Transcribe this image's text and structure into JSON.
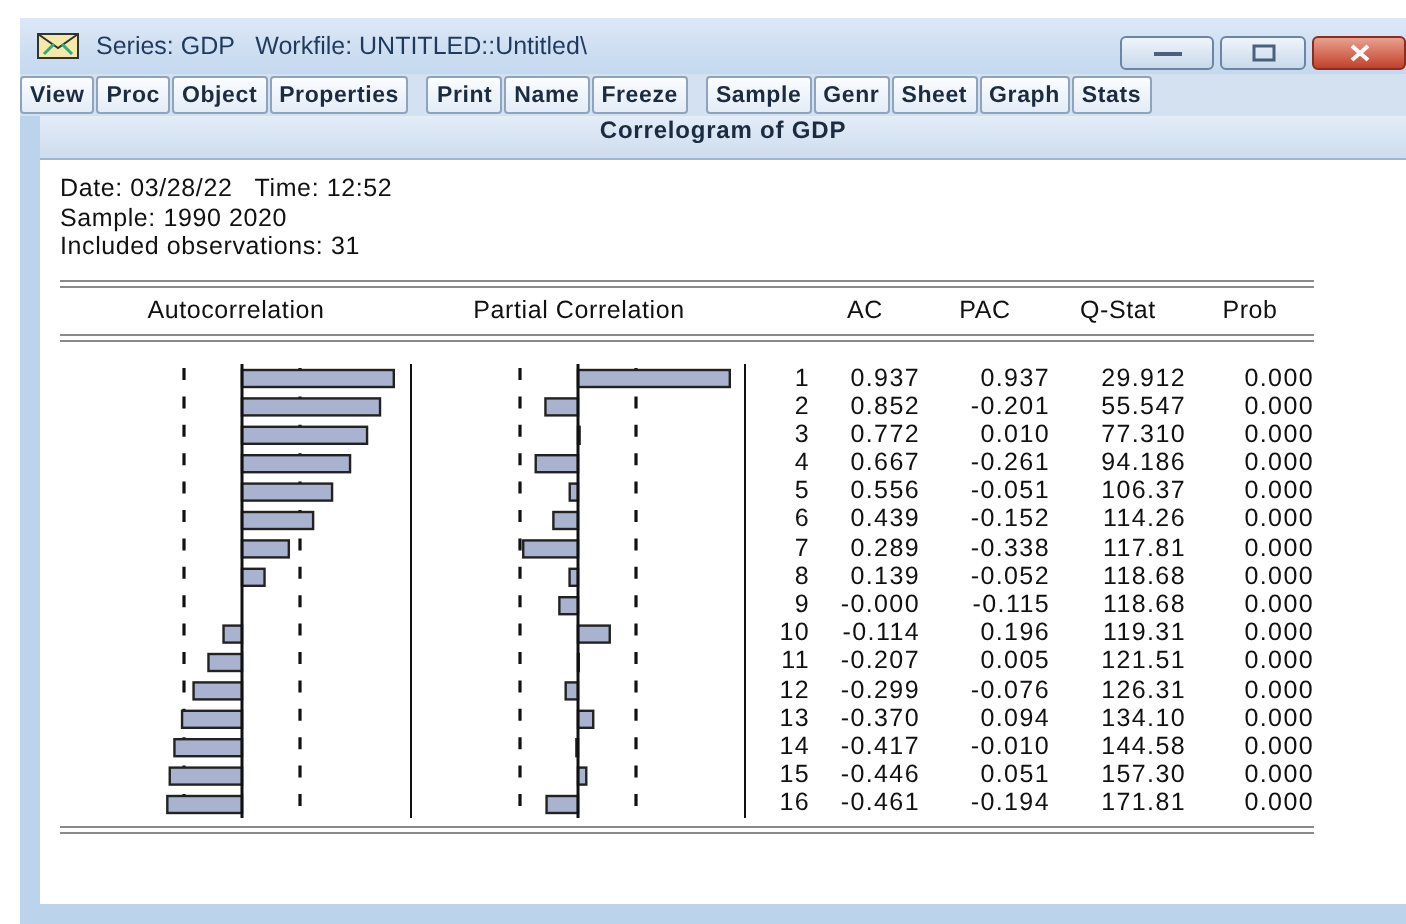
{
  "window": {
    "title": "Series: GDP   Workfile: UNTITLED::Untitled\\"
  },
  "toolbar": [
    {
      "buttons": [
        "View",
        "Proc",
        "Object",
        "Properties"
      ]
    },
    {
      "buttons": [
        "Print",
        "Name",
        "Freeze"
      ]
    },
    {
      "buttons": [
        "Sample",
        "Genr",
        "Sheet",
        "Graph",
        "Stats"
      ]
    }
  ],
  "view_title": "Correlogram of GDP",
  "info_lines": [
    "Date: 03/28/22   Time: 12:52",
    "Sample: 1990 2020",
    "Included observations: 31"
  ],
  "table": {
    "columns": [
      "Autocorrelation",
      "Partial Correlation",
      "AC",
      "PAC",
      "Q-Stat",
      "Prob"
    ],
    "rows": [
      {
        "lag": "1",
        "ac": "0.937",
        "pac": "0.937",
        "q_stat": "29.912",
        "prob": "0.000"
      },
      {
        "lag": "2",
        "ac": "0.852",
        "pac": "-0.201",
        "q_stat": "55.547",
        "prob": "0.000"
      },
      {
        "lag": "3",
        "ac": "0.772",
        "pac": "0.010",
        "q_stat": "77.310",
        "prob": "0.000"
      },
      {
        "lag": "4",
        "ac": "0.667",
        "pac": "-0.261",
        "q_stat": "94.186",
        "prob": "0.000"
      },
      {
        "lag": "5",
        "ac": "0.556",
        "pac": "-0.051",
        "q_stat": "106.37",
        "prob": "0.000"
      },
      {
        "lag": "6",
        "ac": "0.439",
        "pac": "-0.152",
        "q_stat": "114.26",
        "prob": "0.000"
      },
      {
        "lag": "7",
        "ac": "0.289",
        "pac": "-0.338",
        "q_stat": "117.81",
        "prob": "0.000"
      },
      {
        "lag": "8",
        "ac": "0.139",
        "pac": "-0.052",
        "q_stat": "118.68",
        "prob": "0.000"
      },
      {
        "lag": "9",
        "ac": "-0.000",
        "pac": "-0.115",
        "q_stat": "118.68",
        "prob": "0.000"
      },
      {
        "lag": "10",
        "ac": "-0.114",
        "pac": "0.196",
        "q_stat": "119.31",
        "prob": "0.000"
      },
      {
        "lag": "11",
        "ac": "-0.207",
        "pac": "0.005",
        "q_stat": "121.51",
        "prob": "0.000"
      },
      {
        "lag": "12",
        "ac": "-0.299",
        "pac": "-0.076",
        "q_stat": "126.31",
        "prob": "0.000"
      },
      {
        "lag": "13",
        "ac": "-0.370",
        "pac": "0.094",
        "q_stat": "134.10",
        "prob": "0.000"
      },
      {
        "lag": "14",
        "ac": "-0.417",
        "pac": "-0.010",
        "q_stat": "144.58",
        "prob": "0.000"
      },
      {
        "lag": "15",
        "ac": "-0.446",
        "pac": "0.051",
        "q_stat": "157.30",
        "prob": "0.000"
      },
      {
        "lag": "16",
        "ac": "-0.461",
        "pac": "-0.194",
        "q_stat": "171.81",
        "prob": "0.000"
      }
    ]
  }
}
